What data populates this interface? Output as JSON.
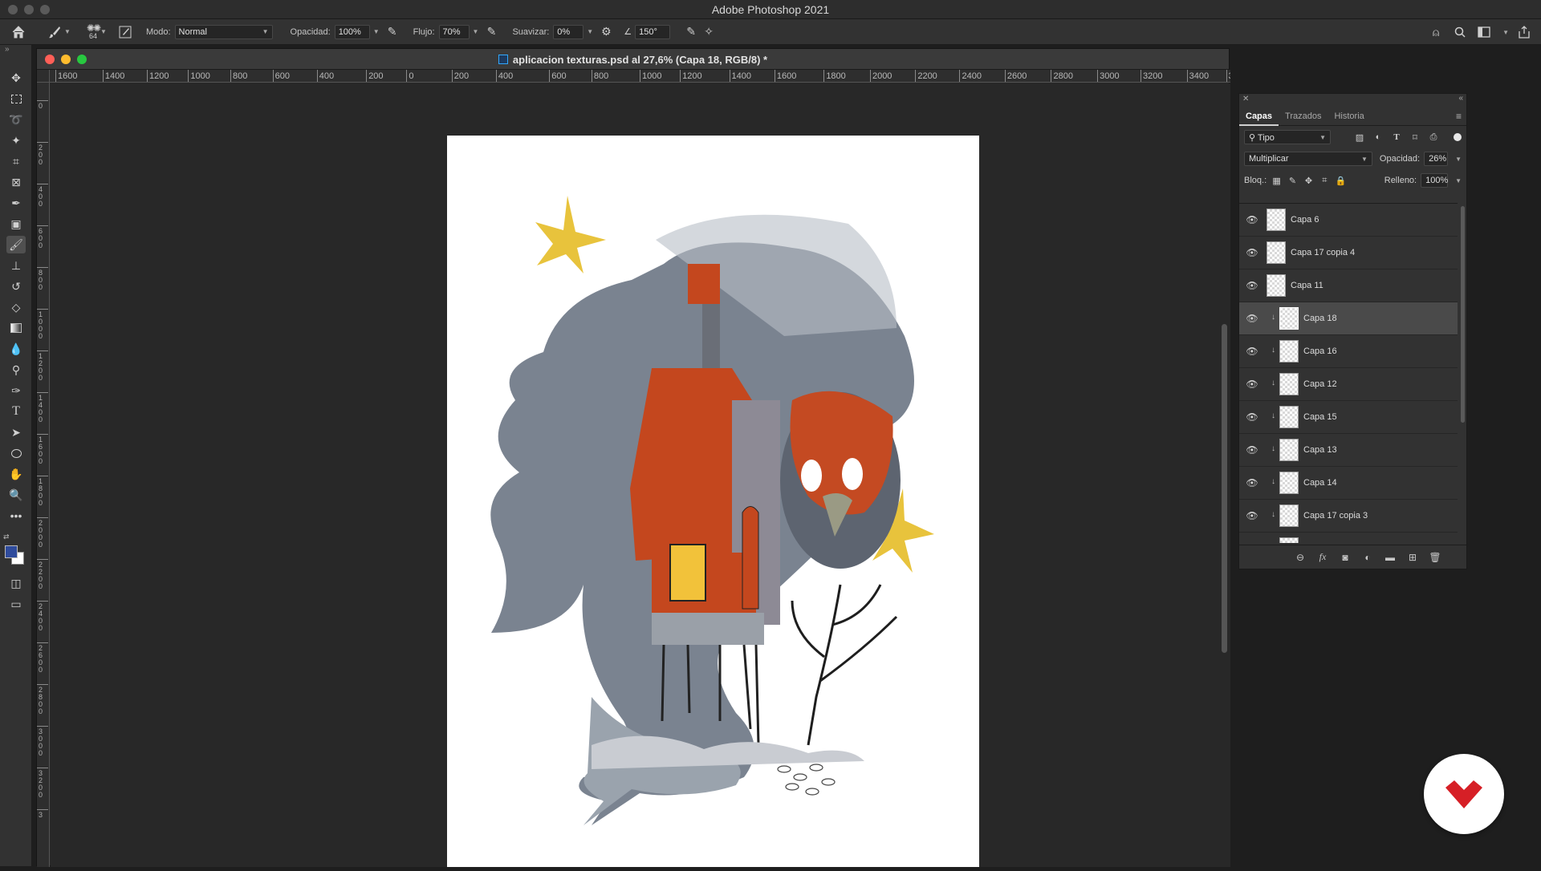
{
  "app": {
    "title": "Adobe Photoshop 2021"
  },
  "options_bar": {
    "brush_size": "64",
    "modo_label": "Modo:",
    "modo_value": "Normal",
    "opacidad_label": "Opacidad:",
    "opacidad_value": "100%",
    "flujo_label": "Flujo:",
    "flujo_value": "70%",
    "suavizar_label": "Suavizar:",
    "suavizar_value": "0%",
    "angle_value": "150°"
  },
  "document": {
    "title": "aplicacion texturas.psd al 27,6% (Capa 18, RGB/8) *",
    "ruler_h": [
      "1600",
      "1400",
      "1200",
      "1000",
      "800",
      "600",
      "400",
      "200",
      "0",
      "200",
      "400",
      "600",
      "800",
      "1000",
      "1200",
      "1400",
      "1600",
      "1800",
      "2000",
      "2200",
      "2400",
      "2600",
      "2800",
      "3000",
      "3200",
      "3400",
      "3"
    ],
    "ruler_v": [
      [
        "0"
      ],
      [
        "2",
        "0",
        "0"
      ],
      [
        "4",
        "0",
        "0"
      ],
      [
        "6",
        "0",
        "0"
      ],
      [
        "8",
        "0",
        "0"
      ],
      [
        "1",
        "0",
        "0",
        "0"
      ],
      [
        "1",
        "2",
        "0",
        "0"
      ],
      [
        "1",
        "4",
        "0",
        "0"
      ],
      [
        "1",
        "6",
        "0",
        "0"
      ],
      [
        "1",
        "8",
        "0",
        "0"
      ],
      [
        "2",
        "0",
        "0",
        "0"
      ],
      [
        "2",
        "2",
        "0",
        "0"
      ],
      [
        "2",
        "4",
        "0",
        "0"
      ],
      [
        "2",
        "6",
        "0",
        "0"
      ],
      [
        "2",
        "8",
        "0",
        "0"
      ],
      [
        "3",
        "0",
        "0",
        "0"
      ],
      [
        "3",
        "2",
        "0",
        "0"
      ],
      [
        "3"
      ]
    ]
  },
  "layers_panel": {
    "tabs": [
      "Capas",
      "Trazados",
      "Historia"
    ],
    "filter_value": "Tipo",
    "blend_mode": "Multiplicar",
    "opacity_label": "Opacidad:",
    "opacity_value": "26%",
    "lock_label": "Bloq.:",
    "fill_label": "Relleno:",
    "fill_value": "100%",
    "layers": [
      {
        "name": "Capa 6",
        "clipped": false,
        "selected": false
      },
      {
        "name": "Capa 17 copia 4",
        "clipped": false,
        "selected": false
      },
      {
        "name": "Capa 11",
        "clipped": false,
        "selected": false
      },
      {
        "name": "Capa 18",
        "clipped": true,
        "selected": true
      },
      {
        "name": "Capa 16",
        "clipped": true,
        "selected": false
      },
      {
        "name": "Capa 12",
        "clipped": true,
        "selected": false
      },
      {
        "name": "Capa 15",
        "clipped": true,
        "selected": false
      },
      {
        "name": "Capa 13",
        "clipped": true,
        "selected": false
      },
      {
        "name": "Capa 14",
        "clipped": true,
        "selected": false
      },
      {
        "name": "Capa 17 copia 3",
        "clipped": true,
        "selected": false
      },
      {
        "name": "",
        "clipped": true,
        "selected": false
      }
    ]
  },
  "colors": {
    "foreground": "#2f4b9c",
    "background": "#ffffff",
    "brand_red": "#d61f26"
  },
  "icons": {
    "toolbar": [
      "move-icon",
      "marquee-icon",
      "lasso-icon",
      "magic-wand-icon",
      "crop-icon",
      "frame-icon",
      "eyedropper-icon",
      "healing-icon",
      "brush-icon",
      "stamp-icon",
      "history-brush-icon",
      "eraser-icon",
      "gradient-icon",
      "blur-icon",
      "dodge-icon",
      "pen-icon",
      "type-icon",
      "path-select-icon",
      "ellipse-icon",
      "hand-icon",
      "zoom-icon",
      "more-icon"
    ]
  }
}
